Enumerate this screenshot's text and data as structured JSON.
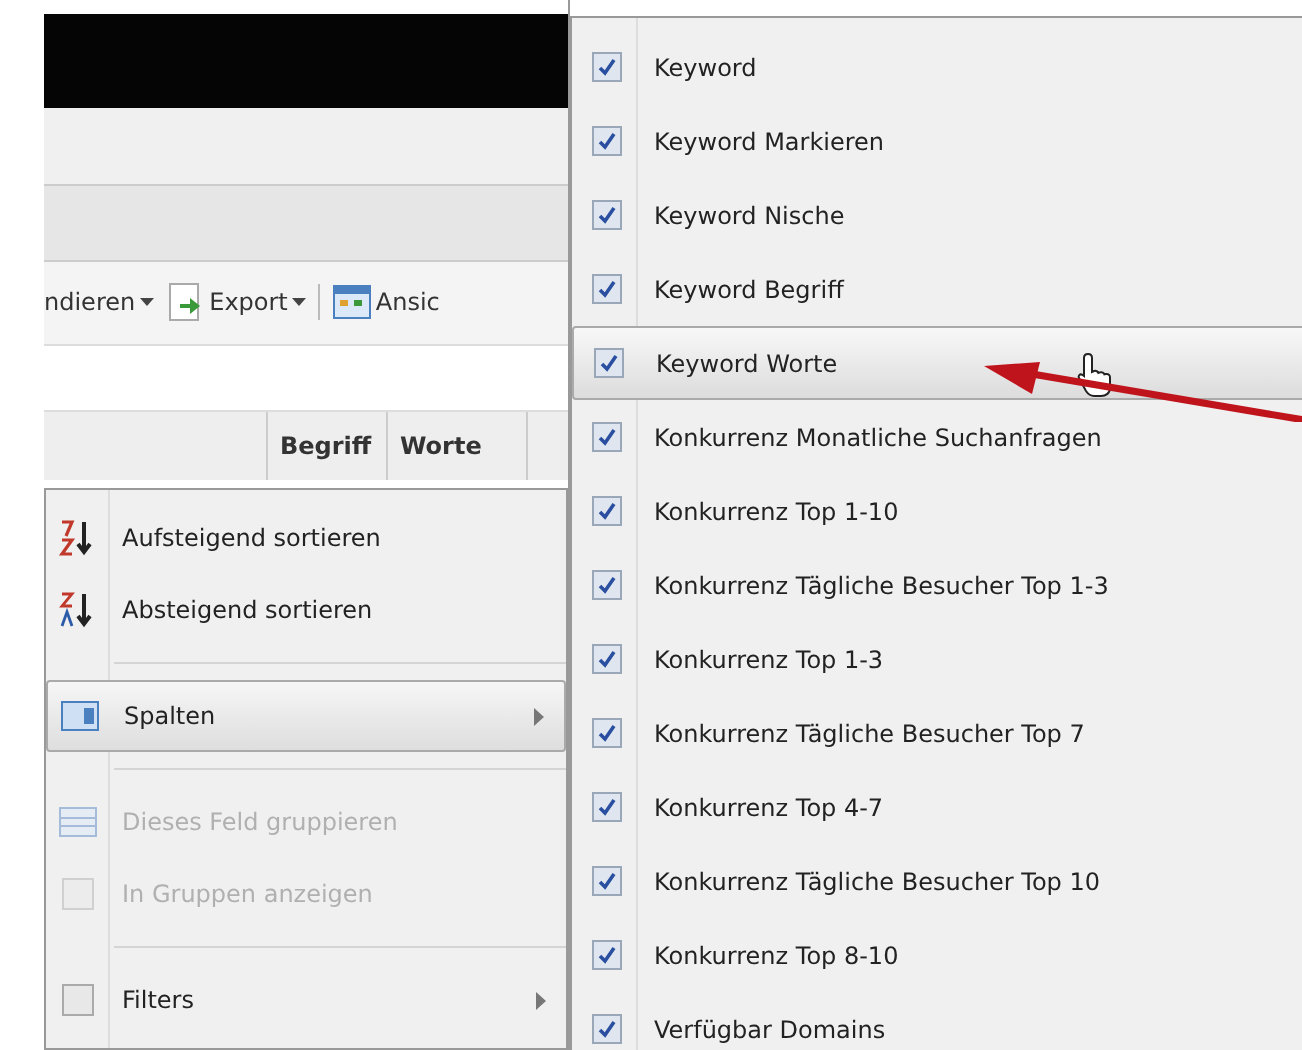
{
  "toolbar": {
    "items": [
      {
        "kind": "dropdown",
        "label": "ndieren"
      },
      {
        "kind": "export",
        "label": "Export"
      },
      {
        "kind": "view",
        "label": "Ansic"
      }
    ]
  },
  "columns": [
    "Begriff",
    "Worte"
  ],
  "column_menu": {
    "items": [
      {
        "kind": "sort-asc",
        "label": "Aufsteigend sortieren",
        "selected": false,
        "disabled": false,
        "submenu": false
      },
      {
        "kind": "sort-desc",
        "label": "Absteigend sortieren",
        "selected": false,
        "disabled": false,
        "submenu": false
      },
      {
        "kind": "columns",
        "label": "Spalten",
        "selected": true,
        "disabled": false,
        "submenu": true
      },
      {
        "kind": "group",
        "label": "Dieses Feld gruppieren",
        "selected": false,
        "disabled": true,
        "submenu": false
      },
      {
        "kind": "checkbox",
        "label": "In Gruppen anzeigen",
        "selected": false,
        "disabled": true,
        "submenu": false
      },
      {
        "kind": "checkbox",
        "label": "Filters",
        "selected": false,
        "disabled": false,
        "submenu": true
      }
    ]
  },
  "columns_submenu": {
    "items": [
      {
        "label": "Keyword",
        "checked": true,
        "selected": false
      },
      {
        "label": "Keyword Markieren",
        "checked": true,
        "selected": false
      },
      {
        "label": "Keyword Nische",
        "checked": true,
        "selected": false
      },
      {
        "label": "Keyword Begriff",
        "checked": true,
        "selected": false
      },
      {
        "label": "Keyword Worte",
        "checked": true,
        "selected": true
      },
      {
        "label": "Konkurrenz Monatliche Suchanfragen",
        "checked": true,
        "selected": false
      },
      {
        "label": "Konkurrenz Top 1-10",
        "checked": true,
        "selected": false
      },
      {
        "label": "Konkurrenz Tägliche Besucher Top 1-3",
        "checked": true,
        "selected": false
      },
      {
        "label": "Konkurrenz Top 1-3",
        "checked": true,
        "selected": false
      },
      {
        "label": "Konkurrenz Tägliche Besucher Top 7",
        "checked": true,
        "selected": false
      },
      {
        "label": "Konkurrenz Top 4-7",
        "checked": true,
        "selected": false
      },
      {
        "label": "Konkurrenz Tägliche Besucher Top 10",
        "checked": true,
        "selected": false
      },
      {
        "label": "Konkurrenz Top 8-10",
        "checked": true,
        "selected": false
      },
      {
        "label": "Verfügbar Domains",
        "checked": true,
        "selected": false
      }
    ]
  }
}
